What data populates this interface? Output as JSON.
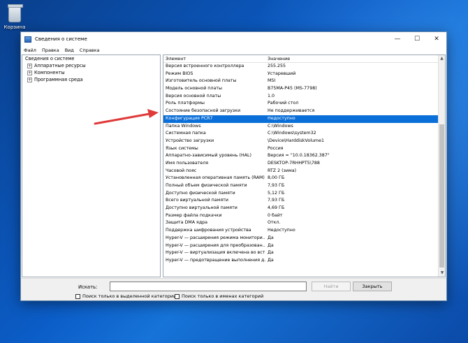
{
  "desktop": {
    "recycle_label": "Корзина"
  },
  "window": {
    "title": "Сведения о системе",
    "controls": {
      "minimize": "—",
      "maximize": "☐",
      "close": "✕"
    }
  },
  "menu": [
    "Файл",
    "Правка",
    "Вид",
    "Справка"
  ],
  "tree": {
    "root": "Сведения о системе",
    "children": [
      "Аппаратные ресурсы",
      "Компоненты",
      "Программная среда"
    ]
  },
  "table": {
    "columns": [
      "Элемент",
      "Значение"
    ],
    "selected_index": 7,
    "rows": [
      [
        "Версия встроенного контроллера",
        "255.255"
      ],
      [
        "Режим BIOS",
        "Устаревший"
      ],
      [
        "Изготовитель основной платы",
        "MSI"
      ],
      [
        "Модель основной платы",
        "B75MA-P45 (MS-7798)"
      ],
      [
        "Версия основной платы",
        "1.0"
      ],
      [
        "Роль платформы",
        "Рабочий стол"
      ],
      [
        "Состояние безопасной загрузки",
        "Не поддерживается"
      ],
      [
        "Конфигурация PCR7",
        "Недоступно"
      ],
      [
        "Папка Windows",
        "C:\\Windows"
      ],
      [
        "Системная папка",
        "C:\\Windows\\system32"
      ],
      [
        "Устройство загрузки",
        "\\Device\\HarddiskVolume1"
      ],
      [
        "Язык системы",
        "Россия"
      ],
      [
        "Аппаратно-зависимый уровень (HAL)",
        "Версия = \"10.0.18362.387\""
      ],
      [
        "Имя пользователя",
        "DESKTOP-7RHHPT5\\788"
      ],
      [
        "Часовой пояс",
        "RTZ 2 (зима)"
      ],
      [
        "Установленная оперативная память (RAM)",
        "8,00 ГБ"
      ],
      [
        "Полный объем физической памяти",
        "7,93 ГБ"
      ],
      [
        "Доступно физической памяти",
        "5,12 ГБ"
      ],
      [
        "Всего виртуальной памяти",
        "7,93 ГБ"
      ],
      [
        "Доступно виртуальной памяти",
        "4,69 ГБ"
      ],
      [
        "Размер файла подкачки",
        "0 байт"
      ],
      [
        "Защита DMA ядра",
        "Откл."
      ],
      [
        "Поддержка шифрования устройства",
        "Недоступно"
      ],
      [
        "Hyper-V — расширения режима монитори...",
        "Да"
      ],
      [
        "Hyper-V — расширения для преобразован...",
        "Да"
      ],
      [
        "Hyper-V — виртуализация включена во вст...",
        "Да"
      ],
      [
        "Hyper-V — предотвращение выполнения д...",
        "Да"
      ]
    ]
  },
  "search": {
    "label": "Искать:",
    "value": "",
    "find_button": "Найти",
    "close_button": "Закрыть",
    "check_selected": "Поиск только в выделенной категории",
    "check_names": "Поиск только в именах категорий"
  },
  "colors": {
    "selection": "#0a6fd8",
    "arrow": "#e03a3a"
  },
  "icons": [
    "recycle-bin-icon",
    "app-icon",
    "expand-plus-icon",
    "arrow-annotation-icon"
  ]
}
